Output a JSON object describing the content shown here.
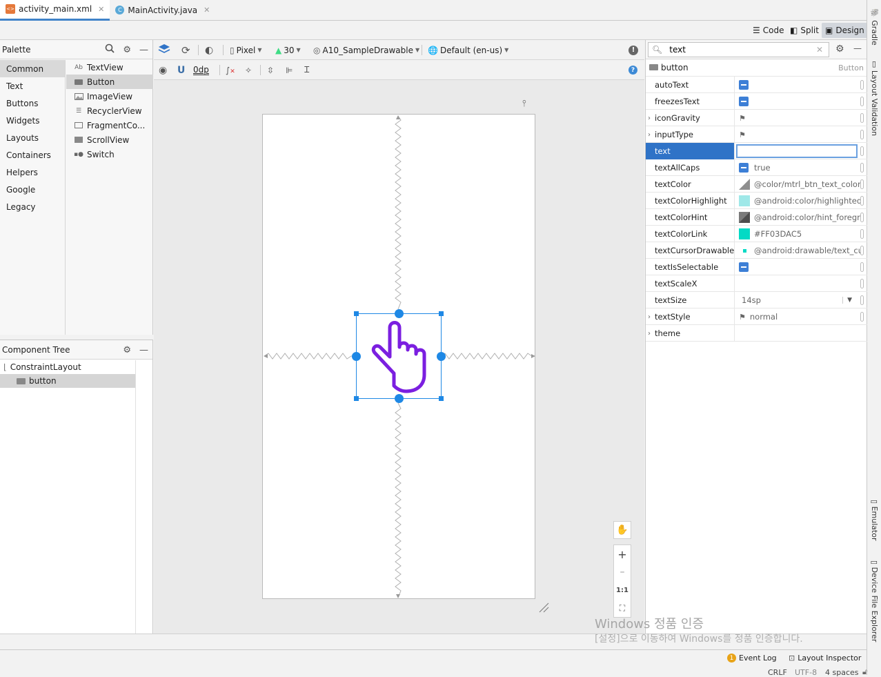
{
  "tabs": [
    {
      "label": "activity_main.xml",
      "active": true,
      "icon": "xml-file-icon"
    },
    {
      "label": "MainActivity.java",
      "active": false,
      "icon": "java-class-icon"
    }
  ],
  "view_modes": {
    "code": "Code",
    "split": "Split",
    "design": "Design",
    "selected": "Design"
  },
  "right_strip": [
    "Gradle",
    "Layout Validation",
    "Emulator",
    "Device File Explorer"
  ],
  "palette": {
    "title": "Palette",
    "categories": [
      "Common",
      "Text",
      "Buttons",
      "Widgets",
      "Layouts",
      "Containers",
      "Helpers",
      "Google",
      "Legacy"
    ],
    "selected_category": "Common",
    "items": [
      {
        "label": "TextView",
        "icon": "Ab"
      },
      {
        "label": "Button"
      },
      {
        "label": "ImageView"
      },
      {
        "label": "RecyclerView"
      },
      {
        "label": "FragmentCo..."
      },
      {
        "label": "ScrollView"
      },
      {
        "label": "Switch"
      }
    ],
    "selected_item": "Button"
  },
  "component_tree": {
    "title": "Component Tree",
    "items": [
      {
        "label": "ConstraintLayout",
        "depth": 0
      },
      {
        "label": "button",
        "depth": 1,
        "selected": true
      }
    ]
  },
  "design_toolbar": {
    "device": "Pixel",
    "api": "30",
    "theme": "A10_SampleDrawable",
    "locale": "Default (en-us)",
    "margin": "0dp"
  },
  "zoom_controls": {
    "reset": "1:1",
    "zoom_in": "+",
    "zoom_out": "–"
  },
  "attributes": {
    "search_value": "text",
    "component_name": "button",
    "component_type": "Button",
    "rows": [
      {
        "name": "autoText",
        "kind": "check",
        "value": ""
      },
      {
        "name": "freezesText",
        "kind": "check",
        "value": ""
      },
      {
        "name": "iconGravity",
        "kind": "flag",
        "value": "",
        "expandable": true
      },
      {
        "name": "inputType",
        "kind": "flag",
        "value": "",
        "expandable": true
      },
      {
        "name": "text",
        "kind": "input",
        "value": "",
        "selected": true
      },
      {
        "name": "textAllCaps",
        "kind": "check",
        "value": "true"
      },
      {
        "name": "textColor",
        "kind": "swatch",
        "value": "@color/mtrl_btn_text_color_",
        "color": "#8e8e8e"
      },
      {
        "name": "textColorHighlight",
        "kind": "swatch",
        "value": "@android:color/highlighted_",
        "color": "#9fe8e8"
      },
      {
        "name": "textColorHint",
        "kind": "swatch",
        "value": "@android:color/hint_foregrc",
        "color": "#7a7a7a"
      },
      {
        "name": "textColorLink",
        "kind": "swatch",
        "value": "#FF03DAC5",
        "color": "#03DAC5"
      },
      {
        "name": "textCursorDrawable",
        "kind": "dot",
        "value": "@android:drawable/text_cur",
        "color": "#03DAC5"
      },
      {
        "name": "textIsSelectable",
        "kind": "check",
        "value": ""
      },
      {
        "name": "textScaleX",
        "kind": "text",
        "value": ""
      },
      {
        "name": "textSize",
        "kind": "dropdown",
        "value": "14sp"
      },
      {
        "name": "textStyle",
        "kind": "flag",
        "value": "normal",
        "expandable": true
      },
      {
        "name": "theme",
        "kind": "text",
        "value": "",
        "expandable": true
      }
    ]
  },
  "status_bar": {
    "event_log": "Event Log",
    "event_count": "1",
    "layout_inspector": "Layout Inspector",
    "line_sep": "CRLF",
    "encoding": "UTF-8",
    "indent": "4 spaces"
  },
  "watermark": {
    "line1": "Windows 정품 인증",
    "line2": "[설정]으로 이동하여 Windows를 정품 인증합니다."
  },
  "colors": {
    "accent": "#2f73c7",
    "selection_handle": "#1e88e5",
    "button_icon": "#7b1fe0"
  }
}
